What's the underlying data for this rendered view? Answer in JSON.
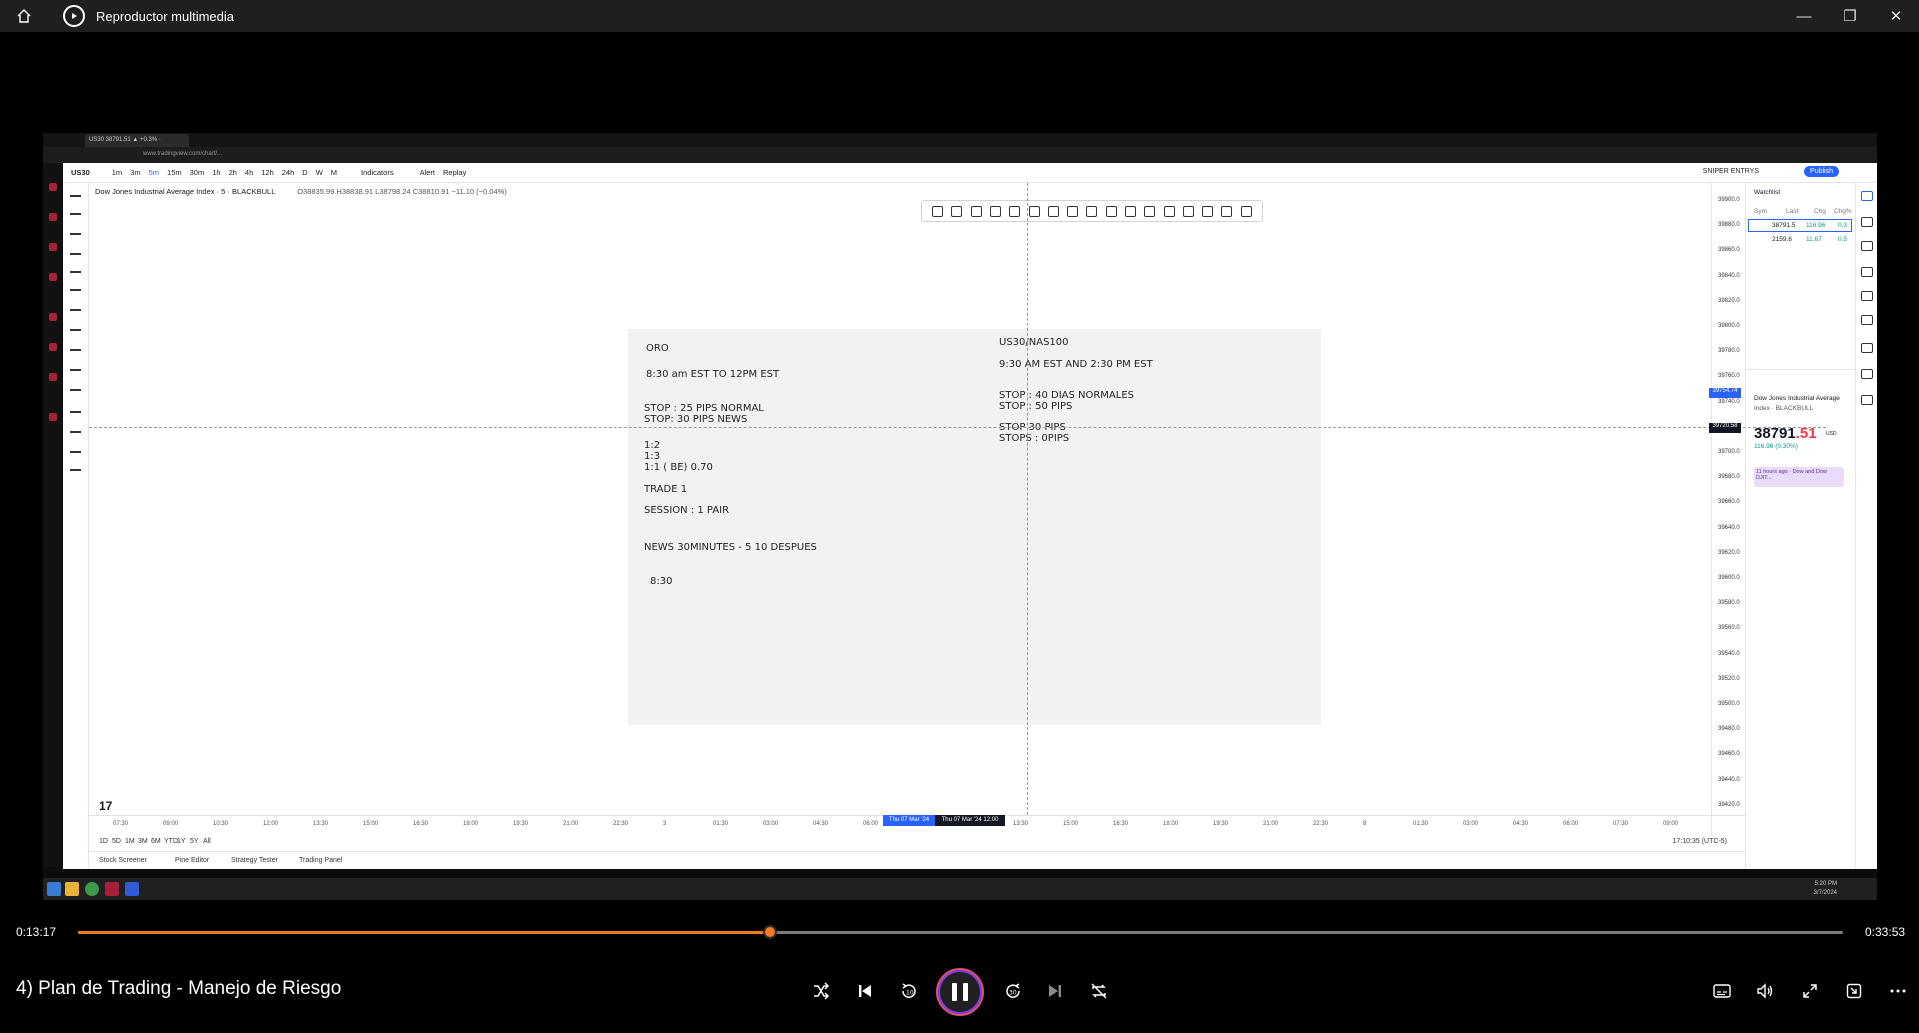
{
  "window": {
    "title": "Reproductor multimedia",
    "controls": [
      "minimize-icon",
      "restore-icon",
      "close-icon"
    ]
  },
  "browser": {
    "tab_title": "US30 38791.51 ▲ +0.3% ·",
    "url": "www.tradingview.com/chart/..."
  },
  "tradingview": {
    "symbol": "US30",
    "timeframes": [
      "1m",
      "3m",
      "5m",
      "15m",
      "30m",
      "1h",
      "2h",
      "4h",
      "12h",
      "24h",
      "D",
      "W",
      "M"
    ],
    "indicators_label": "Indicators",
    "alert_label": "Alert",
    "replay_label": "Replay",
    "super_entries_label": "SNIPER ENTRYS",
    "publish_label": "Publish",
    "legend_title": "Dow Jones Industrial Average Index · 5 · BLACKBULL",
    "legend_ohlc": "O38835.99 H38838.91 L38798.24 C38810.91 −11.10 (−0.04%)",
    "price_ticks": [
      "39900.0",
      "39880.0",
      "39860.0",
      "39840.0",
      "39820.0",
      "39800.0",
      "39780.0",
      "39760.0",
      "39740.0",
      "39720.0",
      "39700.0",
      "39680.0",
      "39660.0",
      "39640.0",
      "39620.0",
      "39600.0",
      "39580.0",
      "39560.0",
      "39540.0",
      "39520.0",
      "39500.0",
      "39480.0",
      "39460.0",
      "39440.0",
      "39420.0"
    ],
    "price_tag_blue": "39754.74",
    "price_tag_dark": "39720.58",
    "time_ticks": [
      "07:30",
      "09:00",
      "10:30",
      "12:00",
      "13:30",
      "15:00",
      "16:30",
      "18:00",
      "19:30",
      "21:00",
      "22:30",
      "3",
      "01:30",
      "03:00",
      "04:30",
      "06:00",
      "07:30",
      "09:00",
      "13:30",
      "15:00",
      "16:30",
      "18:00",
      "19:30",
      "21:00",
      "22:30",
      "8",
      "01:30",
      "03:00",
      "04:30",
      "06:00",
      "07:30",
      "09:00"
    ],
    "date_tag_blue": "Thu 07 Mar '24",
    "date_tag_dark": "Thu 07 Mar '24  12:00",
    "ranges": [
      "1D",
      "5D",
      "1M",
      "3M",
      "6M",
      "YTD",
      "1Y",
      "5Y",
      "All"
    ],
    "clock": "17:10:35 (UTC-5)",
    "bottom_tabs": [
      "Stock Screener",
      "Pine Editor",
      "Strategy Tester",
      "Trading Panel"
    ],
    "watchlist": {
      "header": "Watchlist",
      "columns": [
        "Sym",
        "Last",
        "Chg",
        "Chg%"
      ],
      "rows": [
        {
          "last": "38791.5",
          "chg": "116.96",
          "pct": "0.3"
        },
        {
          "last": "2159.6",
          "chg": "11.67",
          "pct": "0.5"
        }
      ],
      "detail_name": "Dow Jones Industrial Average",
      "detail_sub": "Index · BLACKBULL",
      "detail_price_main": "38791",
      "detail_price_dec": ".51",
      "detail_currency": "USD",
      "detail_change": "116.96 (0.30%)",
      "news": "11 hours ago · Dow and Dow DJIT..."
    }
  },
  "note": {
    "left": {
      "title": "ORO",
      "hours": "8:30 am EST TO 12PM EST",
      "stop_normal": "STOP : 25 PIPS NORMAL",
      "stop_news": "STOP:  30 PIPS NEWS",
      "rr1": "1:2",
      "rr2": "1:3",
      "rr3": "1:1 ( BE) 0.70",
      "trade": "TRADE 1",
      "session": "SESSION : 1 PAIR",
      "news": "NEWS 30MINUTES - 5 10 DESPUES",
      "time": "8:30"
    },
    "right": {
      "title": "US30/NAS100",
      "hours": "9:30 AM EST AND 2:30 PM EST",
      "stop1": "STOP : 40 DIAS NORMALES",
      "stop2": "STOP : 50 PIPS",
      "stop3": "STOP  30 PIPS",
      "stop4": "STOPS :  0PIPS"
    }
  },
  "taskbar": {
    "time": "5:20 PM",
    "date": "3/7/2024"
  },
  "player": {
    "current_time": "0:13:17",
    "total_time": "0:33:53",
    "progress": 0.392,
    "video_title": "4) Plan de Trading - Manejo de Riesgo",
    "accent": "#f47a20"
  }
}
